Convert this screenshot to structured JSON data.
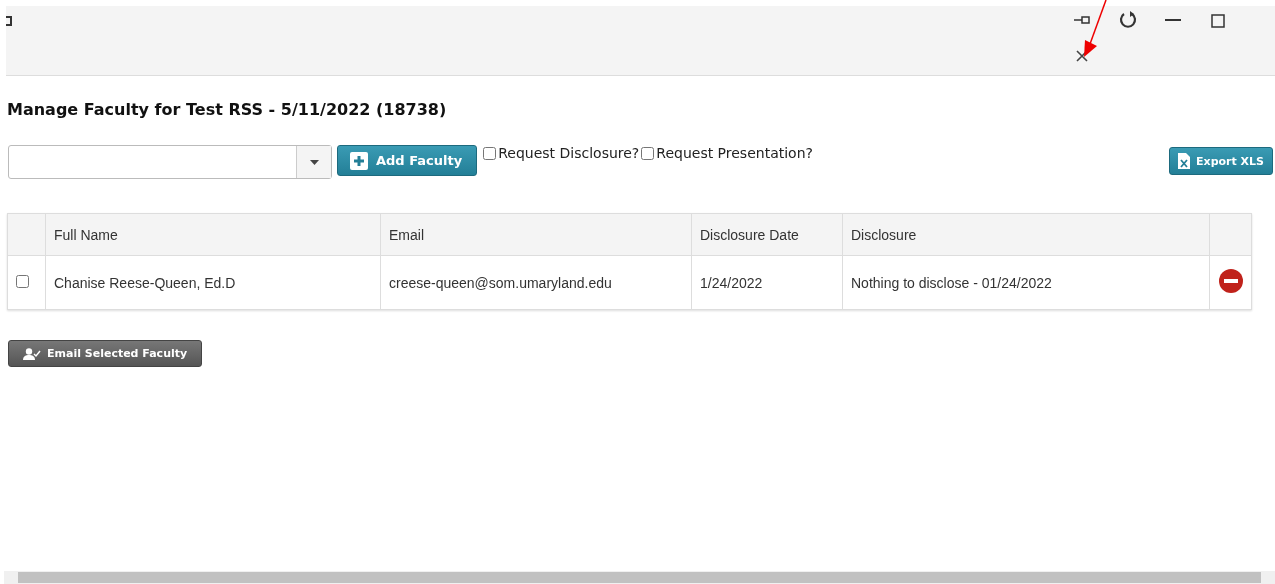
{
  "title": "Manage Faculty for Test RSS - 5/11/2022 (18738)",
  "toolbar": {
    "add_button": "Add Faculty",
    "options": [
      {
        "label": "Request Disclosure?",
        "checked": false
      },
      {
        "label": "Request Presentation?",
        "checked": false
      }
    ],
    "export_button": "Export XLS"
  },
  "table": {
    "columns": [
      "Full Name",
      "Email",
      "Disclosure Date",
      "Disclosure"
    ],
    "rows": [
      {
        "selected": false,
        "cells": [
          "Chanise Reese-Queen, Ed.D",
          "creese-queen@som.umaryland.edu",
          "1/24/2022",
          "Nothing to disclose - 01/24/2022"
        ]
      }
    ]
  },
  "email_button": "Email Selected Faculty"
}
